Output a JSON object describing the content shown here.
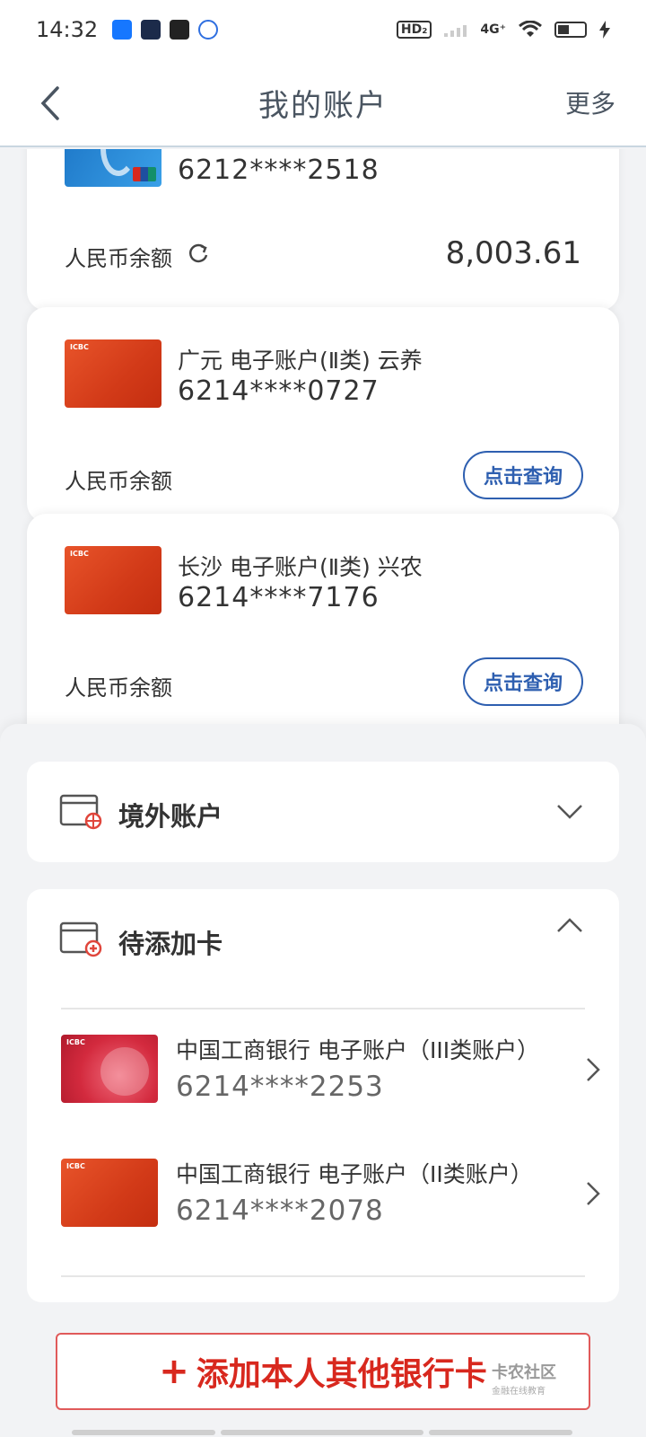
{
  "status_bar": {
    "time": "14:32",
    "network": "4G⁺",
    "hd_label": "HD₂"
  },
  "nav": {
    "title": "我的账户",
    "more": "更多"
  },
  "accounts": [
    {
      "card_style": "unionpay-blue",
      "name": "",
      "number": "6212****2518",
      "balance_label": "人民币余额",
      "balance": "8,003.61"
    },
    {
      "card_style": "icbc-red",
      "name": "广元 电子账户(Ⅱ类) 云养",
      "number": "6214****0727",
      "balance_label": "人民币余额",
      "query_label": "点击查询"
    },
    {
      "card_style": "icbc-red",
      "name": "长沙 电子账户(Ⅱ类) 兴农",
      "number": "6214****7176",
      "balance_label": "人民币余额",
      "query_label": "点击查询"
    }
  ],
  "overseas_section": {
    "title": "境外账户",
    "expanded": false
  },
  "pending_section": {
    "title": "待添加卡",
    "expanded": true,
    "items": [
      {
        "card_style": "icbc-pink",
        "name": "中国工商银行 电子账户（III类账户）",
        "number": "6214****2253"
      },
      {
        "card_style": "icbc-red",
        "name": "中国工商银行 电子账户（II类账户）",
        "number": "6214****2078"
      }
    ]
  },
  "add_card_button": {
    "label": "添加本人其他银行卡"
  },
  "watermark": {
    "text": "卡农社区",
    "sub": "金融在线教育"
  },
  "colors": {
    "accent_blue": "#2e5fb0",
    "add_button_red": "#d8281e",
    "background": "#f2f3f5"
  }
}
